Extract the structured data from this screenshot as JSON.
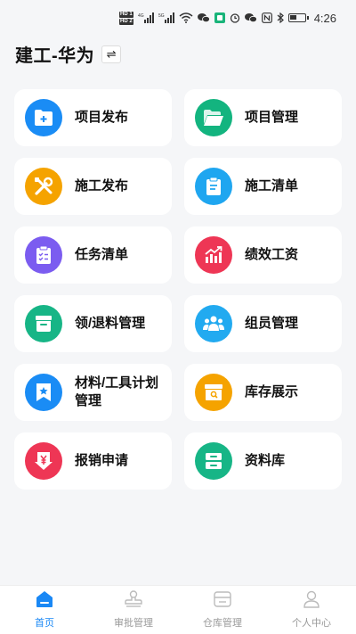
{
  "status_bar": {
    "time": "4:26",
    "hd_top": "HD 1",
    "hd_bottom": "HD 2",
    "net1": "4G",
    "net2": "5G"
  },
  "header": {
    "title": "建工-华为",
    "switch_symbol": "⇌"
  },
  "menu": [
    {
      "label": "项目发布",
      "icon": "folder-add-icon",
      "color": "#1a8cf5"
    },
    {
      "label": "项目管理",
      "icon": "folder-open-icon",
      "color": "#13b47f"
    },
    {
      "label": "施工发布",
      "icon": "tools-icon",
      "color": "#f5a300"
    },
    {
      "label": "施工清单",
      "icon": "clipboard-icon",
      "color": "#1fa6f0"
    },
    {
      "label": "任务清单",
      "icon": "checklist-icon",
      "color": "#7b5cf0"
    },
    {
      "label": "绩效工资",
      "icon": "chart-up-icon",
      "color": "#ee3655"
    },
    {
      "label": "领/退料管理",
      "icon": "inbox-tray-icon",
      "color": "#17b586"
    },
    {
      "label": "组员管理",
      "icon": "group-icon",
      "color": "#22aaf0"
    },
    {
      "label": "材料/工具计划管理",
      "icon": "bookmark-star-icon",
      "color": "#1a8cf5"
    },
    {
      "label": "库存展示",
      "icon": "box-search-icon",
      "color": "#f5a300"
    },
    {
      "label": "报销申请",
      "icon": "yen-download-icon",
      "color": "#ee3655"
    },
    {
      "label": "资料库",
      "icon": "cabinet-icon",
      "color": "#17b586"
    }
  ],
  "tabs": [
    {
      "label": "首页",
      "icon": "home-icon",
      "active": true
    },
    {
      "label": "审批管理",
      "icon": "stamp-icon",
      "active": false
    },
    {
      "label": "仓库管理",
      "icon": "warehouse-icon",
      "active": false
    },
    {
      "label": "个人中心",
      "icon": "user-icon",
      "active": false
    }
  ],
  "colors": {
    "active_tab": "#1a88f5",
    "inactive_tab": "#bbbbbb"
  }
}
